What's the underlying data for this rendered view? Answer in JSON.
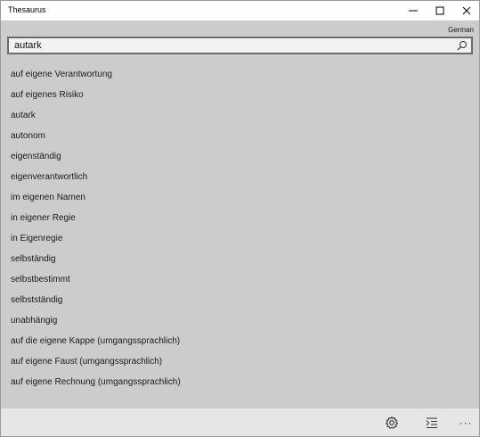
{
  "window": {
    "title": "Thesaurus",
    "minimize_icon": "minimize-icon",
    "maximize_icon": "maximize-icon",
    "close_icon": "close-icon"
  },
  "language": "German",
  "search": {
    "value": "autark",
    "icon": "search-icon"
  },
  "results": [
    "auf eigene Verantwortung",
    "auf eigenes Risiko",
    "autark",
    "autonom",
    "eigenständig",
    "eigenverantwortlich",
    "im eigenen Namen",
    "in eigener Regie",
    "in Eigenregie",
    "selbständig",
    "selbstbestimmt",
    "selbstständig",
    "unabhängig",
    "auf die eigene Kappe (umgangssprachlich)",
    "auf eigene Faust (umgangssprachlich)",
    "auf eigene Rechnung (umgangssprachlich)"
  ],
  "bottombar": {
    "settings_icon": "gear-icon",
    "list_icon": "list-indent-icon",
    "more_icon": "more-icon",
    "more_label": "···"
  },
  "colors": {
    "background": "#cccccc",
    "titlebar": "#ffffff",
    "search_border": "#6b6b6b",
    "bottombar": "#e6e6e6"
  }
}
